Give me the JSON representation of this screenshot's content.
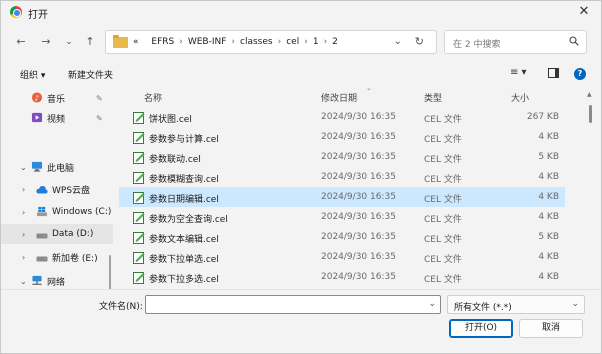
{
  "window": {
    "title": "打开"
  },
  "address": {
    "breadcrumbs": [
      "«",
      "EFRS",
      "WEB-INF",
      "classes",
      "cel",
      "1",
      "2"
    ],
    "search_placeholder": "在 2 中搜索"
  },
  "toolbar": {
    "organize": "组织 ▾",
    "new_folder": "新建文件夹"
  },
  "sidebar": {
    "items": [
      {
        "label": "音乐",
        "icon": "music-icon",
        "pinned": true
      },
      {
        "label": "视频",
        "icon": "video-icon",
        "pinned": true
      },
      {
        "label": "此电脑",
        "icon": "computer-icon",
        "chevron": "⌄"
      },
      {
        "label": "WPS云盘",
        "icon": "cloud-icon",
        "chevron": "›"
      },
      {
        "label": "Windows (C:)",
        "icon": "windows-drive-icon",
        "chevron": "›"
      },
      {
        "label": "Data (D:)",
        "icon": "drive-icon",
        "chevron": "›",
        "selected": true
      },
      {
        "label": "新加卷 (E:)",
        "icon": "drive-icon",
        "chevron": "›"
      },
      {
        "label": "网络",
        "icon": "network-icon",
        "chevron": "⌄"
      }
    ]
  },
  "file_list": {
    "columns": [
      "名称",
      "修改日期",
      "类型",
      "大小"
    ],
    "rows": [
      {
        "name": "饼状图.cel",
        "date": "2024/9/30 16:35",
        "type": "CEL 文件",
        "size": "267 KB"
      },
      {
        "name": "参数参与计算.cel",
        "date": "2024/9/30 16:35",
        "type": "CEL 文件",
        "size": "4 KB"
      },
      {
        "name": "参数联动.cel",
        "date": "2024/9/30 16:35",
        "type": "CEL 文件",
        "size": "5 KB"
      },
      {
        "name": "参数模糊查询.cel",
        "date": "2024/9/30 16:35",
        "type": "CEL 文件",
        "size": "4 KB"
      },
      {
        "name": "参数日期编辑.cel",
        "date": "2024/9/30 16:35",
        "type": "CEL 文件",
        "size": "4 KB",
        "selected": true
      },
      {
        "name": "参数为空全查询.cel",
        "date": "2024/9/30 16:35",
        "type": "CEL 文件",
        "size": "4 KB"
      },
      {
        "name": "参数文本编辑.cel",
        "date": "2024/9/30 16:35",
        "type": "CEL 文件",
        "size": "5 KB"
      },
      {
        "name": "参数下拉单选.cel",
        "date": "2024/9/30 16:35",
        "type": "CEL 文件",
        "size": "4 KB"
      },
      {
        "name": "参数下拉多选.cel",
        "date": "2024/9/30 16:35",
        "type": "CEL 文件",
        "size": "4 KB"
      }
    ]
  },
  "footer": {
    "filename_label": "文件名(N):",
    "filename_value": "",
    "filetype_value": "所有文件 (*.*)",
    "open_label": "打开(O)",
    "cancel_label": "取消"
  },
  "colors": {
    "accent": "#0067c0",
    "selection": "#cce8ff",
    "folder": "#e8b84a"
  }
}
